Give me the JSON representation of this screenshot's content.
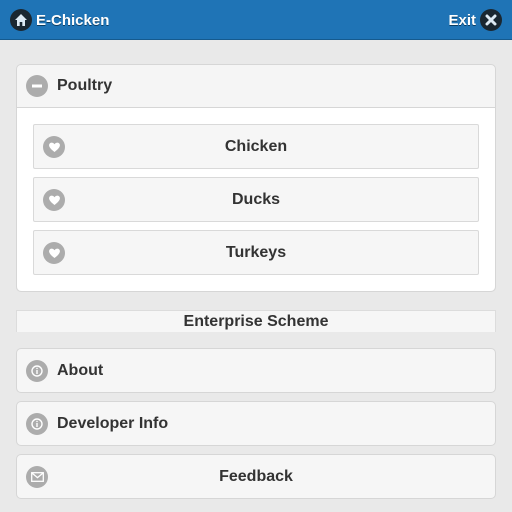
{
  "header": {
    "title": "E-Chicken",
    "exit_label": "Exit",
    "home_icon": "home-icon",
    "exit_icon": "close-icon",
    "bar_color": "#1f74b6"
  },
  "poultry": {
    "label": "Poultry",
    "icon": "minus-icon",
    "expanded": true,
    "items": [
      {
        "label": "Chicken",
        "icon": "heart-icon"
      },
      {
        "label": "Ducks",
        "icon": "heart-icon"
      },
      {
        "label": "Turkeys",
        "icon": "heart-icon"
      }
    ]
  },
  "divider": {
    "label": "Enterprise Scheme"
  },
  "menu": [
    {
      "label": "About",
      "icon": "info-icon"
    },
    {
      "label": "Developer Info",
      "icon": "info-icon"
    },
    {
      "label": "Feedback",
      "icon": "mail-icon"
    }
  ]
}
